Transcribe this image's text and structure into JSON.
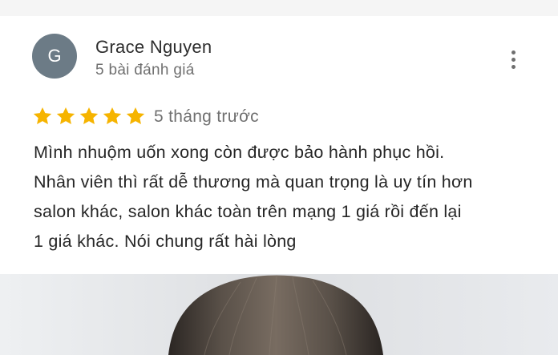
{
  "review": {
    "avatar_letter": "G",
    "reviewer_name": "Grace Nguyen",
    "review_count": "5 bài đánh giá",
    "rating": 5,
    "rating_max": 5,
    "time_ago": "5 tháng trước",
    "text_lines": [
      "Mình nhuộm uốn xong còn được bảo hành phục hồi.",
      "Nhân viên thì rất dễ thương mà quan trọng là uy tín hơn",
      "salon khác, salon khác toàn trên mạng 1 giá rồi đến lại",
      "1 giá khác. Nói chung rất hài lòng"
    ]
  },
  "colors": {
    "avatar_bg": "#6c7b86",
    "star": "#f6b400",
    "text_primary": "#262626",
    "text_secondary": "#707070"
  },
  "icons": {
    "menu": "more-vert-icon",
    "star": "star-icon"
  }
}
